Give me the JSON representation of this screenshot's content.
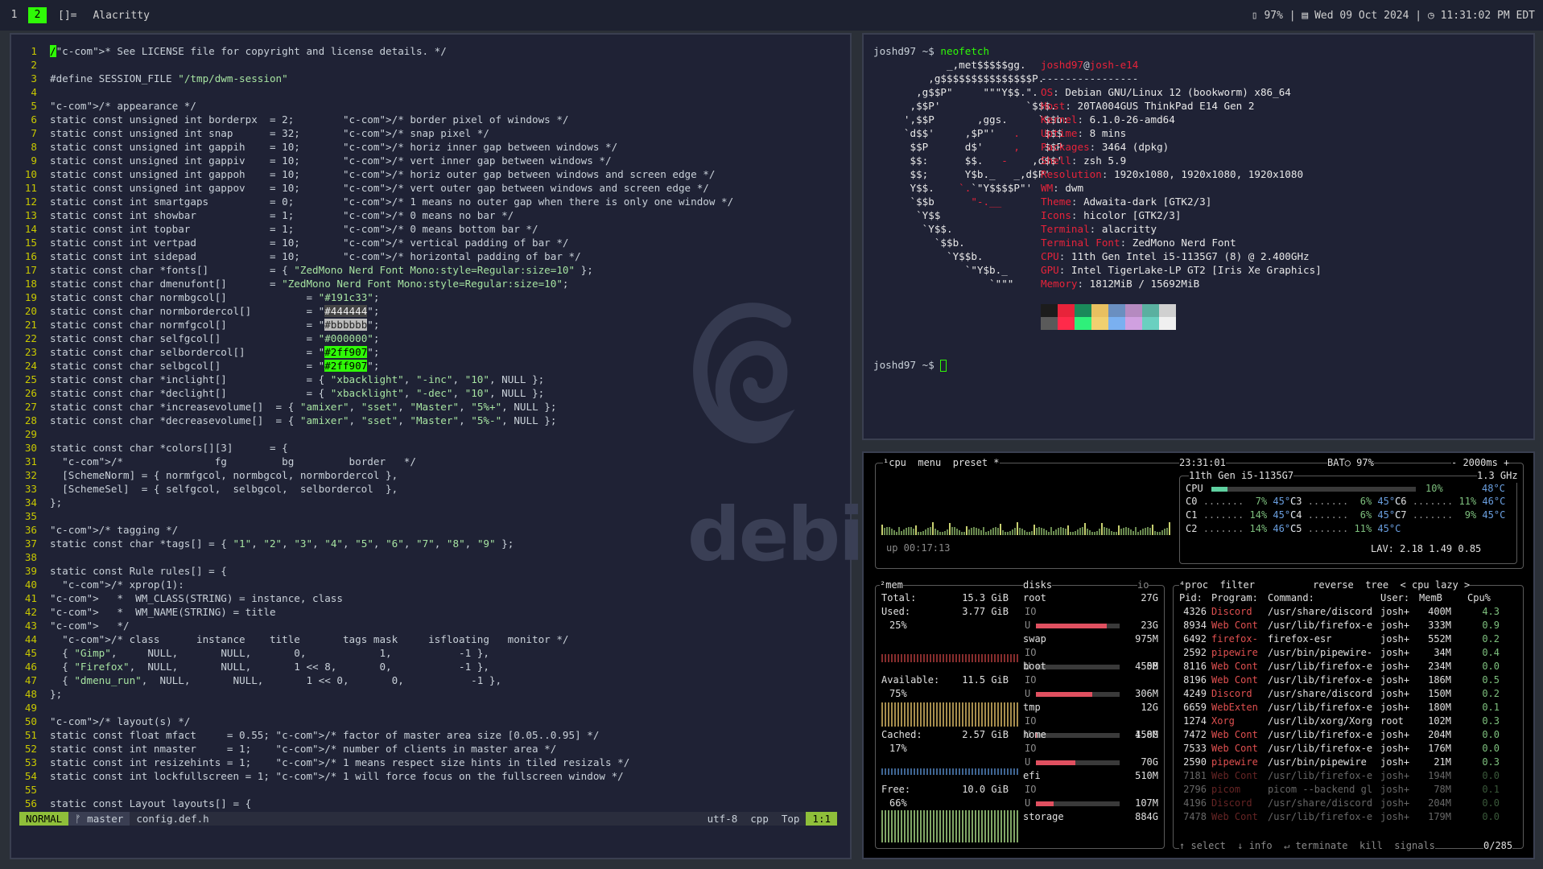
{
  "bar": {
    "tags": [
      "1",
      "2",
      "[]="
    ],
    "active_tag": "2",
    "window_title": "Alacritty",
    "status": "▯ 97% | ▤ Wed 09 Oct 2024 | ◷ 11:31:02 PM EDT"
  },
  "vim": {
    "mode": "NORMAL",
    "branch": "ᚠ master",
    "filename": "config.def.h",
    "encoding": "utf-8",
    "filetype": "cpp",
    "scroll": "Top",
    "position": "1:1",
    "lines": [
      "/* See LICENSE file for copyright and license details. */",
      "",
      "#define SESSION_FILE \"/tmp/dwm-session\"",
      "",
      "/* appearance */",
      "static const unsigned int borderpx  = 2;        /* border pixel of windows */",
      "static const unsigned int snap      = 32;       /* snap pixel */",
      "static const unsigned int gappih    = 10;       /* horiz inner gap between windows */",
      "static const unsigned int gappiv    = 10;       /* vert inner gap between windows */",
      "static const unsigned int gappoh    = 10;       /* horiz outer gap between windows and screen edge */",
      "static const unsigned int gappov    = 10;       /* vert outer gap between windows and screen edge */",
      "static const int smartgaps          = 0;        /* 1 means no outer gap when there is only one window */",
      "static const int showbar            = 1;        /* 0 means no bar */",
      "static const int topbar             = 1;        /* 0 means bottom bar */",
      "static const int vertpad            = 10;       /* vertical padding of bar */",
      "static const int sidepad            = 10;       /* horizontal padding of bar */",
      "static const char *fonts[]          = { \"ZedMono Nerd Font Mono:style=Regular:size=10\" };",
      "static const char dmenufont[]       = \"ZedMono Nerd Font Mono:style=Regular:size=10\";",
      "static const char normbgcol[]             = \"#191c33\";",
      "static const char normbordercol[]         = \"#444444\";",
      "static const char normfgcol[]             = \"#bbbbbb\";",
      "static const char selfgcol[]              = \"#000000\";",
      "static const char selbordercol[]          = \"#2ff907\";",
      "static const char selbgcol[]              = \"#2ff907\";",
      "static const char *inclight[]             = { \"xbacklight\", \"-inc\", \"10\", NULL };",
      "static const char *declight[]             = { \"xbacklight\", \"-dec\", \"10\", NULL };",
      "static const char *increasevolume[]  = { \"amixer\", \"sset\", \"Master\", \"5%+\", NULL };",
      "static const char *decreasevolume[]  = { \"amixer\", \"sset\", \"Master\", \"5%-\", NULL };",
      "",
      "static const char *colors[][3]      = {",
      "  /*               fg         bg         border   */",
      "  [SchemeNorm] = { normfgcol, normbgcol, normbordercol },",
      "  [SchemeSel]  = { selfgcol,  selbgcol,  selbordercol  },",
      "};",
      "",
      "/* tagging */",
      "static const char *tags[] = { \"1\", \"2\", \"3\", \"4\", \"5\", \"6\", \"7\", \"8\", \"9\" };",
      "",
      "static const Rule rules[] = {",
      "  /* xprop(1):",
      "   *  WM_CLASS(STRING) = instance, class",
      "   *  WM_NAME(STRING) = title",
      "   */",
      "  /* class      instance    title       tags mask     isfloating   monitor */",
      "  { \"Gimp\",     NULL,       NULL,       0,            1,           -1 },",
      "  { \"Firefox\",  NULL,       NULL,       1 << 8,       0,           -1 },",
      "  { \"dmenu_run\",  NULL,       NULL,       1 << 0,       0,           -1 },",
      "};",
      "",
      "/* layout(s) */",
      "static const float mfact     = 0.55; /* factor of master area size [0.05..0.95] */",
      "static const int nmaster     = 1;    /* number of clients in master area */",
      "static const int resizehints = 1;    /* 1 means respect size hints in tiled resizals */",
      "static const int lockfullscreen = 1; /* 1 will force focus on the fullscreen window */",
      "",
      "static const Layout layouts[] = {"
    ],
    "watermark": "debian"
  },
  "neofetch": {
    "prompt": "joshd97 ~$ ",
    "command": "neofetch",
    "user_host": "joshd97@josh-e14",
    "separator": "----------------",
    "info": [
      {
        "k": "OS",
        "v": "Debian GNU/Linux 12 (bookworm) x86_64"
      },
      {
        "k": "Host",
        "v": "20TA004GUS ThinkPad E14 Gen 2"
      },
      {
        "k": "Kernel",
        "v": "6.1.0-26-amd64"
      },
      {
        "k": "Uptime",
        "v": "8 mins"
      },
      {
        "k": "Packages",
        "v": "3464 (dpkg)"
      },
      {
        "k": "Shell",
        "v": "zsh 5.9"
      },
      {
        "k": "Resolution",
        "v": "1920x1080, 1920x1080, 1920x1080"
      },
      {
        "k": "WM",
        "v": "dwm"
      },
      {
        "k": "Theme",
        "v": "Adwaita-dark [GTK2/3]"
      },
      {
        "k": "Icons",
        "v": "hicolor [GTK2/3]"
      },
      {
        "k": "Terminal",
        "v": "alacritty"
      },
      {
        "k": "Terminal Font",
        "v": "ZedMono Nerd Font"
      },
      {
        "k": "CPU",
        "v": "11th Gen Intel i5-1135G7 (8) @ 2.400GHz"
      },
      {
        "k": "GPU",
        "v": "Intel TigerLake-LP GT2 [Iris Xe Graphics]"
      },
      {
        "k": "Memory",
        "v": "1812MiB / 15692MiB"
      }
    ],
    "swatches": [
      "#1c1c1c",
      "#e8233a",
      "#1a8a5a",
      "#e8c060",
      "#6a8fc0",
      "#b58ac0",
      "#5ab0a0",
      "#d0d0d0",
      "#5a5a5a",
      "#ff2a4a",
      "#2ff07a",
      "#f0d070",
      "#7ab0f0",
      "#d0a0e0",
      "#6ad0c0",
      "#f0f0f0"
    ],
    "prompt2": "joshd97 ~$ "
  },
  "btop": {
    "cpu_tabs": "¹cpu  menu  preset *",
    "clock": "23:31:01",
    "battery": "BAT○ 97%",
    "refresh": "- 2000ms +",
    "cpu_model": "11th Gen i5-1135G7",
    "freq": "1.3 GHz",
    "cpu_total": {
      "label": "CPU",
      "pct": "10%",
      "temp": "48°C"
    },
    "cores": [
      [
        "C0",
        "7%",
        "45°C"
      ],
      [
        "C3",
        "6%",
        "45°C"
      ],
      [
        "C6",
        "11%",
        "46°C"
      ],
      [
        "C1",
        "14%",
        "45°C"
      ],
      [
        "C4",
        "6%",
        "45°C"
      ],
      [
        "C7",
        "9%",
        "45°C"
      ],
      [
        "C2",
        "14%",
        "46°C"
      ],
      [
        "C5",
        "11%",
        "45°C"
      ]
    ],
    "lav": "LAV: 2.18 1.49 0.85",
    "uptime": "up 00:17:13",
    "mem": {
      "title": "²mem",
      "total_label": "Total:",
      "total": "15.3 GiB",
      "used_label": "Used:",
      "used": "3.77 GiB",
      "used_pct": "25%",
      "avail_label": "Available:",
      "avail": "11.5 GiB",
      "avail_pct": "75%",
      "cached_label": "Cached:",
      "cached": "2.57 GiB",
      "cached_pct": "17%",
      "free_label": "Free:",
      "free": "10.0 GiB",
      "free_pct": "66%"
    },
    "disks": {
      "title": "disks",
      "io": "io",
      "items": [
        {
          "name": "root",
          "size": "27G",
          "used": "23G",
          "fill": 0.85
        },
        {
          "name": "swap",
          "size": "975M",
          "used": "0B",
          "fill": 0.0
        },
        {
          "name": "boot",
          "size": "455M",
          "used": "306M",
          "fill": 0.67
        },
        {
          "name": "tmp",
          "size": "12G",
          "used": "4.8M",
          "fill": 0.01
        },
        {
          "name": "home",
          "size": "150G",
          "used": "70G",
          "fill": 0.47
        },
        {
          "name": "efi",
          "size": "510M",
          "used": "107M",
          "fill": 0.21
        },
        {
          "name": "storage",
          "size": "884G",
          "used": "",
          "fill": 0
        }
      ]
    },
    "proc": {
      "tabs": "⁴proc  filter          reverse  tree  < cpu lazy >",
      "header": [
        "Pid:",
        "Program:",
        "Command:",
        "User:",
        "MemB",
        "Cpu%"
      ],
      "rows": [
        [
          "4326",
          "Discord",
          "/usr/share/discord",
          "josh+",
          "400M",
          "4.3"
        ],
        [
          "8934",
          "Web Cont",
          "/usr/lib/firefox-e",
          "josh+",
          "333M",
          "0.9"
        ],
        [
          "6492",
          "firefox-",
          "firefox-esr",
          "josh+",
          "552M",
          "0.2"
        ],
        [
          "2592",
          "pipewire",
          "/usr/bin/pipewire-",
          "josh+",
          "34M",
          "0.4"
        ],
        [
          "8116",
          "Web Cont",
          "/usr/lib/firefox-e",
          "josh+",
          "234M",
          "0.0"
        ],
        [
          "8196",
          "Web Cont",
          "/usr/lib/firefox-e",
          "josh+",
          "186M",
          "0.5"
        ],
        [
          "4249",
          "Discord",
          "/usr/share/discord",
          "josh+",
          "150M",
          "0.2"
        ],
        [
          "6659",
          "WebExten",
          "/usr/lib/firefox-e",
          "josh+",
          "180M",
          "0.1"
        ],
        [
          "1274",
          "Xorg",
          "/usr/lib/xorg/Xorg",
          "root",
          "102M",
          "0.3"
        ],
        [
          "7472",
          "Web Cont",
          "/usr/lib/firefox-e",
          "josh+",
          "204M",
          "0.0"
        ],
        [
          "7533",
          "Web Cont",
          "/usr/lib/firefox-e",
          "josh+",
          "176M",
          "0.0"
        ],
        [
          "2590",
          "pipewire",
          "/usr/bin/pipewire",
          "josh+",
          "21M",
          "0.3"
        ],
        [
          "7181",
          "Web Cont",
          "/usr/lib/firefox-e",
          "josh+",
          "194M",
          "0.0"
        ],
        [
          "2796",
          "picom",
          "picom --backend gl",
          "josh+",
          "78M",
          "0.1"
        ],
        [
          "4196",
          "Discord",
          "/usr/share/discord",
          "josh+",
          "204M",
          "0.0"
        ],
        [
          "7478",
          "Web Cont",
          "/usr/lib/firefox-e",
          "josh+",
          "179M",
          "0.0"
        ]
      ],
      "footer": "↑ select  ↓ info  ↵ terminate  kill  signals",
      "count": "0/285"
    }
  }
}
